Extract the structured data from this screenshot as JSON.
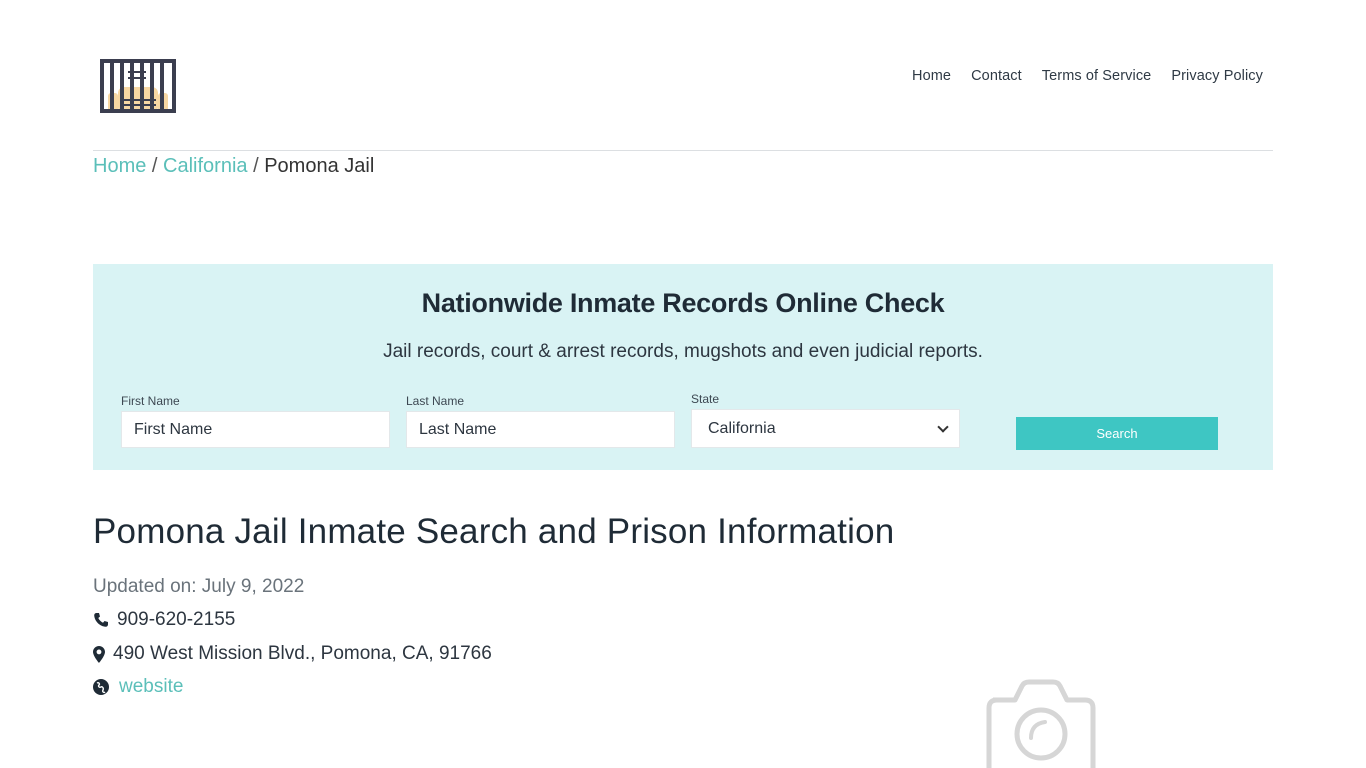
{
  "header": {
    "logo_icon": "jail-cell-icon",
    "nav": [
      {
        "label": "Home"
      },
      {
        "label": "Contact"
      },
      {
        "label": "Terms of Service"
      },
      {
        "label": "Privacy Policy"
      }
    ]
  },
  "breadcrumb": {
    "items": [
      {
        "label": "Home",
        "link": true
      },
      {
        "label": "California",
        "link": true
      },
      {
        "label": "Pomona Jail",
        "link": false
      }
    ],
    "separator": "/"
  },
  "search_panel": {
    "title": "Nationwide Inmate Records Online Check",
    "subtitle": "Jail records, court & arrest records, mugshots and even judicial reports.",
    "first_name": {
      "label": "First Name",
      "placeholder": "First Name",
      "value": ""
    },
    "last_name": {
      "label": "Last Name",
      "placeholder": "Last Name",
      "value": ""
    },
    "state": {
      "label": "State",
      "selected": "California"
    },
    "search_button": "Search",
    "colors": {
      "background": "#d9f3f4",
      "button": "#3ec6c3"
    }
  },
  "main": {
    "title": "Pomona Jail Inmate Search and Prison Information",
    "updated": "Updated on: July 9, 2022",
    "phone": "909-620-2155",
    "address": "490 West Mission Blvd., Pomona, CA, 91766",
    "website_label": "website",
    "image_placeholder_icon": "camera-icon"
  },
  "colors": {
    "link": "#5bbfb9",
    "text": "#1f2b36"
  }
}
